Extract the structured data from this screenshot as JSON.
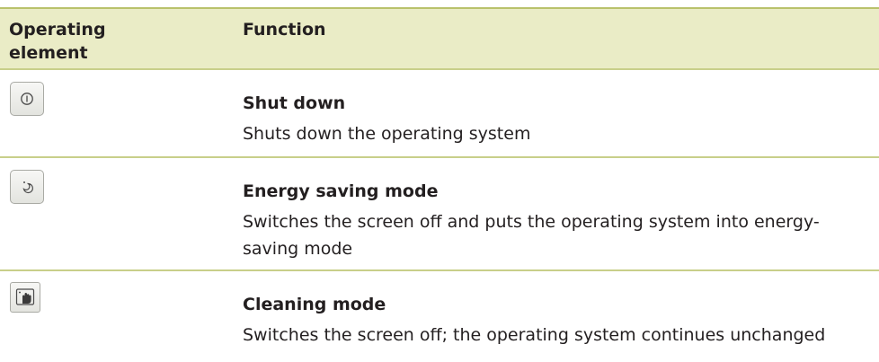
{
  "header": {
    "col1": "Operating element",
    "col2": "Function"
  },
  "rows": [
    {
      "icon": "power-icon",
      "title": "Shut down",
      "description": "Shuts down the operating system"
    },
    {
      "icon": "moon-icon",
      "title": "Energy saving mode",
      "description": "Switches the screen off and puts the operating system into energy-saving mode"
    },
    {
      "icon": "cleaning-hand-icon",
      "title": "Cleaning mode",
      "description": "Switches the screen off; the operating system continues unchanged"
    }
  ]
}
